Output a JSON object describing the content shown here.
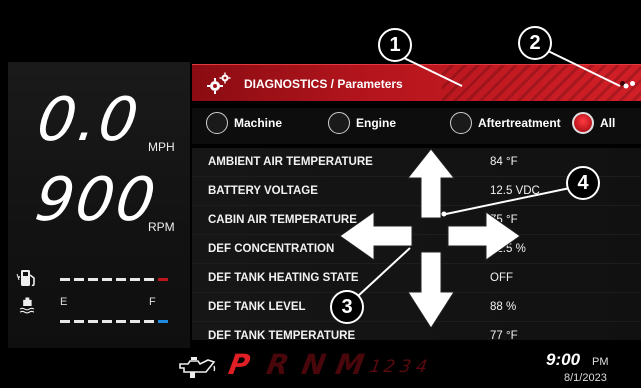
{
  "speedometer": {
    "value": "0.0",
    "unit": "MPH"
  },
  "tachometer": {
    "value": "900",
    "unit": "RPM"
  },
  "fuel_gauge": {
    "icon": "fuel-pump-icon",
    "level": 0.9
  },
  "def_gauge": {
    "icon": "def-fluid-icon",
    "empty_label": "E",
    "full_label": "F",
    "level": 0.88
  },
  "header": {
    "icon": "gears-icon",
    "title": "DIAGNOSTICS / Parameters",
    "accent": "#c8161e",
    "pages": 2,
    "active_page": 2
  },
  "filters": [
    {
      "label": "Machine",
      "selected": false
    },
    {
      "label": "Engine",
      "selected": false
    },
    {
      "label": "Aftertreatment",
      "selected": false
    },
    {
      "label": "All",
      "selected": true
    }
  ],
  "parameters": [
    {
      "name": "AMBIENT AIR TEMPERATURE",
      "value": "84 °F"
    },
    {
      "name": "BATTERY VOLTAGE",
      "value": "12.5 VDC"
    },
    {
      "name": "CABIN AIR TEMPERATURE",
      "value": "75 °F"
    },
    {
      "name": "DEF CONCENTRATION",
      "value": "32.5 %"
    },
    {
      "name": "DEF TANK HEATING STATE",
      "value": "OFF"
    },
    {
      "name": "DEF TANK LEVEL",
      "value": "88 %"
    },
    {
      "name": "DEF TANK TEMPERATURE",
      "value": "77 °F"
    }
  ],
  "transmission": {
    "icon": "oil-can-icon",
    "gears": [
      "P",
      "R",
      "N",
      "M"
    ],
    "active_gear": "P",
    "manual_gears": [
      "1",
      "2",
      "3",
      "4"
    ]
  },
  "clock": {
    "time": "9:00",
    "ampm": "PM",
    "date": "8/1/2023"
  },
  "callouts": [
    "1",
    "2",
    "3",
    "4"
  ]
}
